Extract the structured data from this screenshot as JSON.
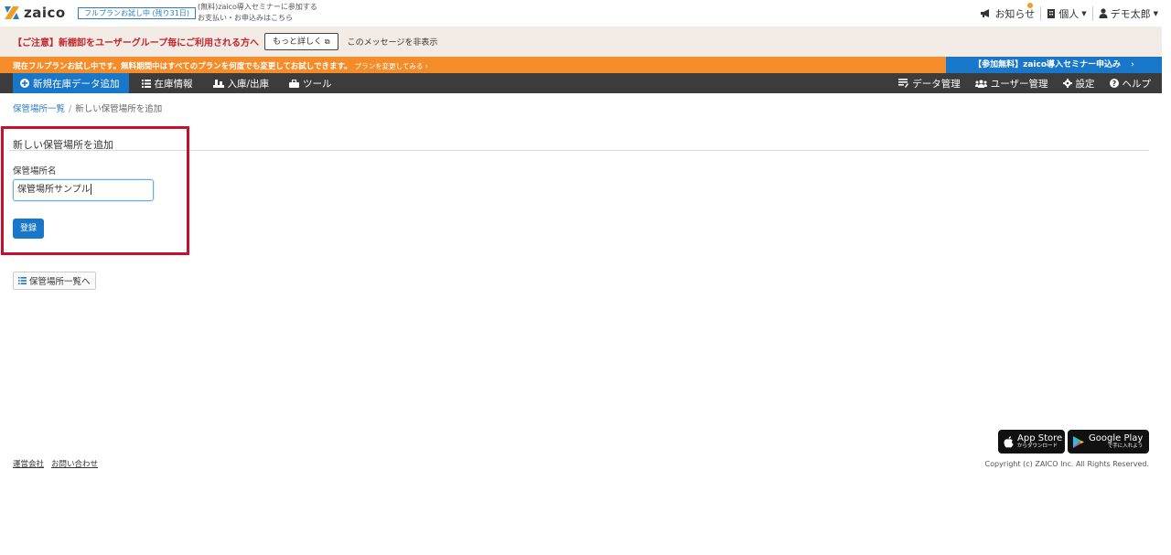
{
  "header": {
    "logo_text": "zaico",
    "trial_badge": "フルプランお試し中 (残り31日)",
    "links": [
      "(無料)zaico導入セミナーに参加する",
      "お支払い・お申込みはこちら"
    ],
    "notifications_label": "お知らせ",
    "workspace_label": "個人",
    "user_label": "デモ太郎"
  },
  "warning": {
    "text": "【ご注意】新棚卸をユーザーグループ毎にご利用される方へ",
    "more_button": "もっと詳しく",
    "hide_label": "このメッセージを非表示"
  },
  "promo": {
    "text": "現在フルプランお試し中です。無料期間中はすべてのプランを何度でも変更してお試しできます。",
    "change_link": "プランを変更してみる ›",
    "seminar_button": "【参加無料】zaico導入セミナー申込み"
  },
  "nav": {
    "left": [
      {
        "label": "新規在庫データ追加",
        "icon": "plus-circle-icon"
      },
      {
        "label": "在庫情報",
        "icon": "list-icon"
      },
      {
        "label": "入庫/出庫",
        "icon": "inout-icon"
      },
      {
        "label": "ツール",
        "icon": "toolbox-icon"
      }
    ],
    "right": [
      {
        "label": "データ管理",
        "icon": "data-icon"
      },
      {
        "label": "ユーザー管理",
        "icon": "users-icon"
      },
      {
        "label": "設定",
        "icon": "gear-icon"
      },
      {
        "label": "ヘルプ",
        "icon": "help-icon"
      }
    ]
  },
  "breadcrumb": {
    "parent": "保管場所一覧",
    "current": "新しい保管場所を追加"
  },
  "form": {
    "title": "新しい保管場所を追加",
    "field_label": "保管場所名",
    "field_value": "保管場所サンプル",
    "submit_label": "登録"
  },
  "back_button": "保管場所一覧へ",
  "footer": {
    "links": [
      "運営会社",
      "お問い合わせ"
    ],
    "app_store": {
      "big": "App Store",
      "small": "からダウンロード"
    },
    "google_play": {
      "big": "Google Play",
      "small": "で手に入れよう"
    },
    "copyright": "Copyright (c) ZAICO Inc. All Rights Reserved."
  },
  "colors": {
    "brand_blue": "#1877c9",
    "promo_orange": "#f48c2a",
    "nav_dark": "#3c3c3c",
    "warning_red": "#c0282d",
    "highlight_red": "#c8102e"
  }
}
